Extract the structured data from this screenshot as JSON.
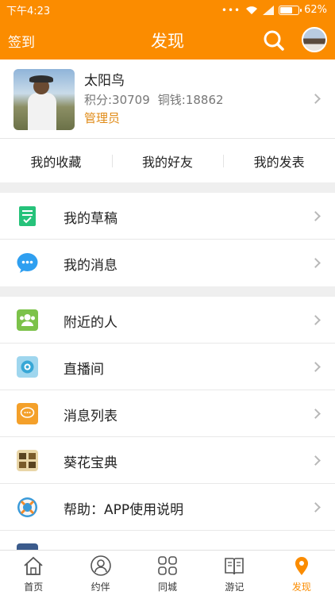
{
  "status_bar": {
    "time": "下午4:23",
    "battery": "62%",
    "battery_level": 0.62
  },
  "header": {
    "left_label": "签到",
    "title": "发现"
  },
  "profile": {
    "name": "太阳鸟",
    "points": "积分:30709",
    "coins": "铜钱:18862",
    "role": "管理员"
  },
  "tabs": [
    "我的收藏",
    "我的好友",
    "我的发表"
  ],
  "group1": [
    {
      "label": "我的草稿",
      "icon": "draft-icon",
      "color": "#26c27a"
    },
    {
      "label": "我的消息",
      "icon": "message-icon",
      "color": "#2f9ff0"
    }
  ],
  "group2": [
    {
      "label": "附近的人",
      "icon": "people-icon",
      "color": "#7cc24a"
    },
    {
      "label": "直播间",
      "icon": "live-icon",
      "color": "#37a7d6"
    },
    {
      "label": "消息列表",
      "icon": "chat-list-icon",
      "color": "#f4a02a"
    },
    {
      "label": "葵花宝典",
      "icon": "book-icon",
      "color": "#c6a36a"
    },
    {
      "label": "帮助：APP使用说明",
      "icon": "lifebuoy-icon",
      "color": "#3a9ad9"
    }
  ],
  "bottom_nav": [
    {
      "label": "首页",
      "icon": "home-icon"
    },
    {
      "label": "约伴",
      "icon": "user-icon"
    },
    {
      "label": "同城",
      "icon": "grid-icon"
    },
    {
      "label": "游记",
      "icon": "notebook-icon"
    },
    {
      "label": "发现",
      "icon": "location-icon",
      "active": true
    }
  ],
  "accent_color": "#fb8c00"
}
